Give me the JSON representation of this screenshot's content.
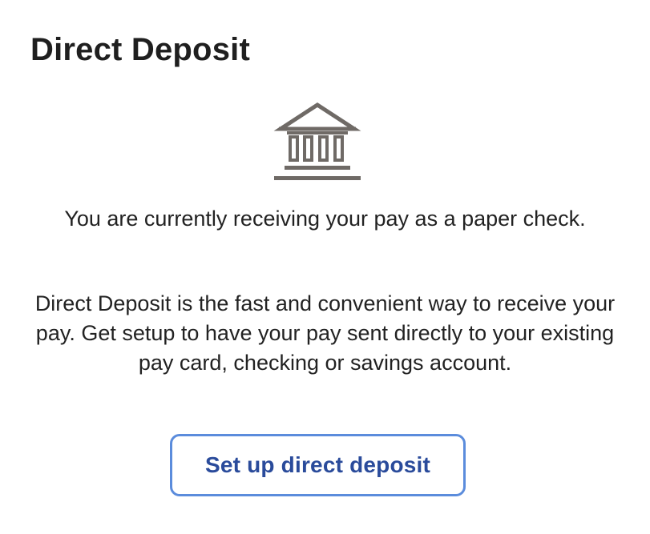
{
  "page": {
    "title": "Direct Deposit"
  },
  "icon": {
    "name": "bank-building-icon",
    "color": "#6f6a66"
  },
  "status": {
    "text": "You are currently receiving your pay as a paper check."
  },
  "description": {
    "text": "Direct Deposit is the fast and convenient way to receive your pay. Get setup to have your pay sent directly to your existing pay card, checking or savings account."
  },
  "action": {
    "button_label": "Set up direct deposit",
    "border_color": "#5b8cdc",
    "text_color": "#2a4b9b"
  }
}
